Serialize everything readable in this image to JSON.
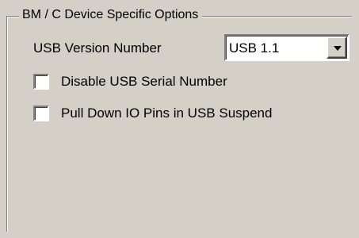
{
  "group": {
    "title": "BM / C Device Specific Options"
  },
  "usb_version": {
    "label": "USB Version Number",
    "selected": "USB 1.1",
    "button_icon": "chevron-down-icon"
  },
  "options": [
    {
      "label": "Disable USB Serial Number",
      "checked": false
    },
    {
      "label": "Pull Down IO Pins in USB Suspend",
      "checked": false
    }
  ],
  "colors": {
    "background": "#d4d0c8",
    "field": "#ffffff",
    "shadow": "#808080",
    "highlight": "#ffffff",
    "text": "#000000"
  }
}
